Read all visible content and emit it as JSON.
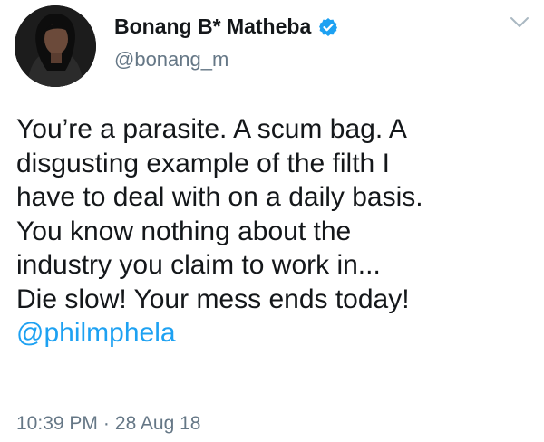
{
  "author": {
    "display_name": "Bonang B* Matheba",
    "handle": "@bonang_m",
    "verified": true
  },
  "tweet": {
    "lines": [
      "You’re a parasite. A scum bag. A",
      "disgusting example of the filth I",
      "have to deal with on a daily basis.",
      "You know nothing about the",
      "industry you claim to work in...",
      "Die slow! Your mess ends today!"
    ],
    "mention": "@philmphela"
  },
  "meta": {
    "time": "10:39 PM",
    "separator": "·",
    "date": "28 Aug 18"
  },
  "icons": {
    "verified": "verified-badge-icon",
    "caret": "chevron-down-icon"
  },
  "colors": {
    "link": "#1da1f2",
    "secondary_text": "#657786",
    "primary_text": "#14171a",
    "verified_badge": "#1da1f2"
  }
}
